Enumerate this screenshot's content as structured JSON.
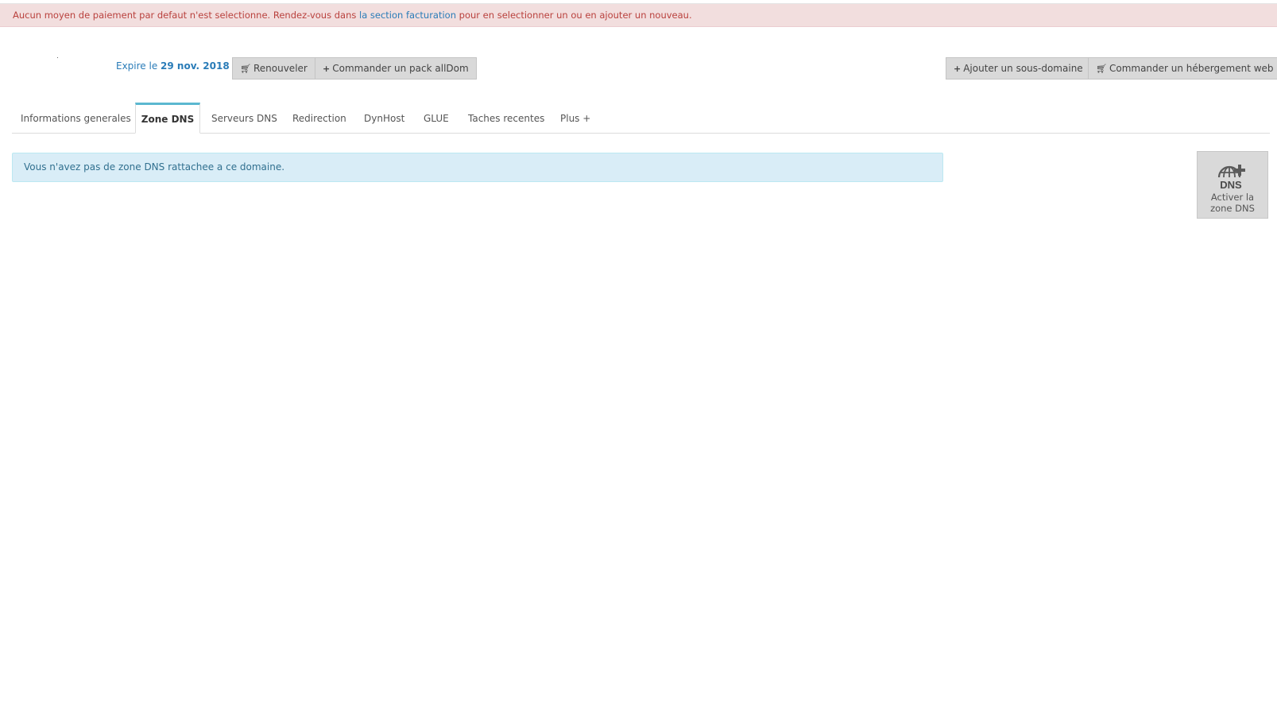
{
  "alert": {
    "text_before": "Aucun moyen de paiement par defaut n'est selectionne. Rendez-vous dans ",
    "link": "la section facturation",
    "text_after": " pour en selectionner un ou en ajouter un nouveau."
  },
  "header": {
    "expire_label": "Expire le ",
    "expire_date": "29 nov. 2018",
    "buttons": {
      "renew": "Renouveler",
      "order_pack": "Commander un pack allDom",
      "add_subdomain": "Ajouter un sous-domaine",
      "order_hosting": "Commander un hébergement web"
    }
  },
  "tabs": [
    {
      "label": "Informations generales"
    },
    {
      "label": "Zone DNS"
    },
    {
      "label": "Serveurs DNS"
    },
    {
      "label": "Redirection"
    },
    {
      "label": "DynHost"
    },
    {
      "label": "GLUE"
    },
    {
      "label": "Taches recentes"
    },
    {
      "label": "Plus +"
    }
  ],
  "active_tab": "Zone DNS",
  "main": {
    "info_message": "Vous n'avez pas de zone DNS rattachee a ce domaine.",
    "tile": {
      "icon_text": "DNS",
      "label_line1": "Activer la",
      "label_line2": "zone DNS"
    }
  },
  "colors": {
    "alert_bg": "#f2dede",
    "alert_text": "#b9413d",
    "link": "#2a7cb8",
    "info_bg": "#d9edf7",
    "info_text": "#31708f",
    "tab_accent": "#5bb8d0",
    "button_bg": "#d9d9d9"
  },
  "icons": {
    "cart": "shopping-cart-icon",
    "plus": "plus-icon",
    "dns_globe": "globe-plus-icon"
  }
}
